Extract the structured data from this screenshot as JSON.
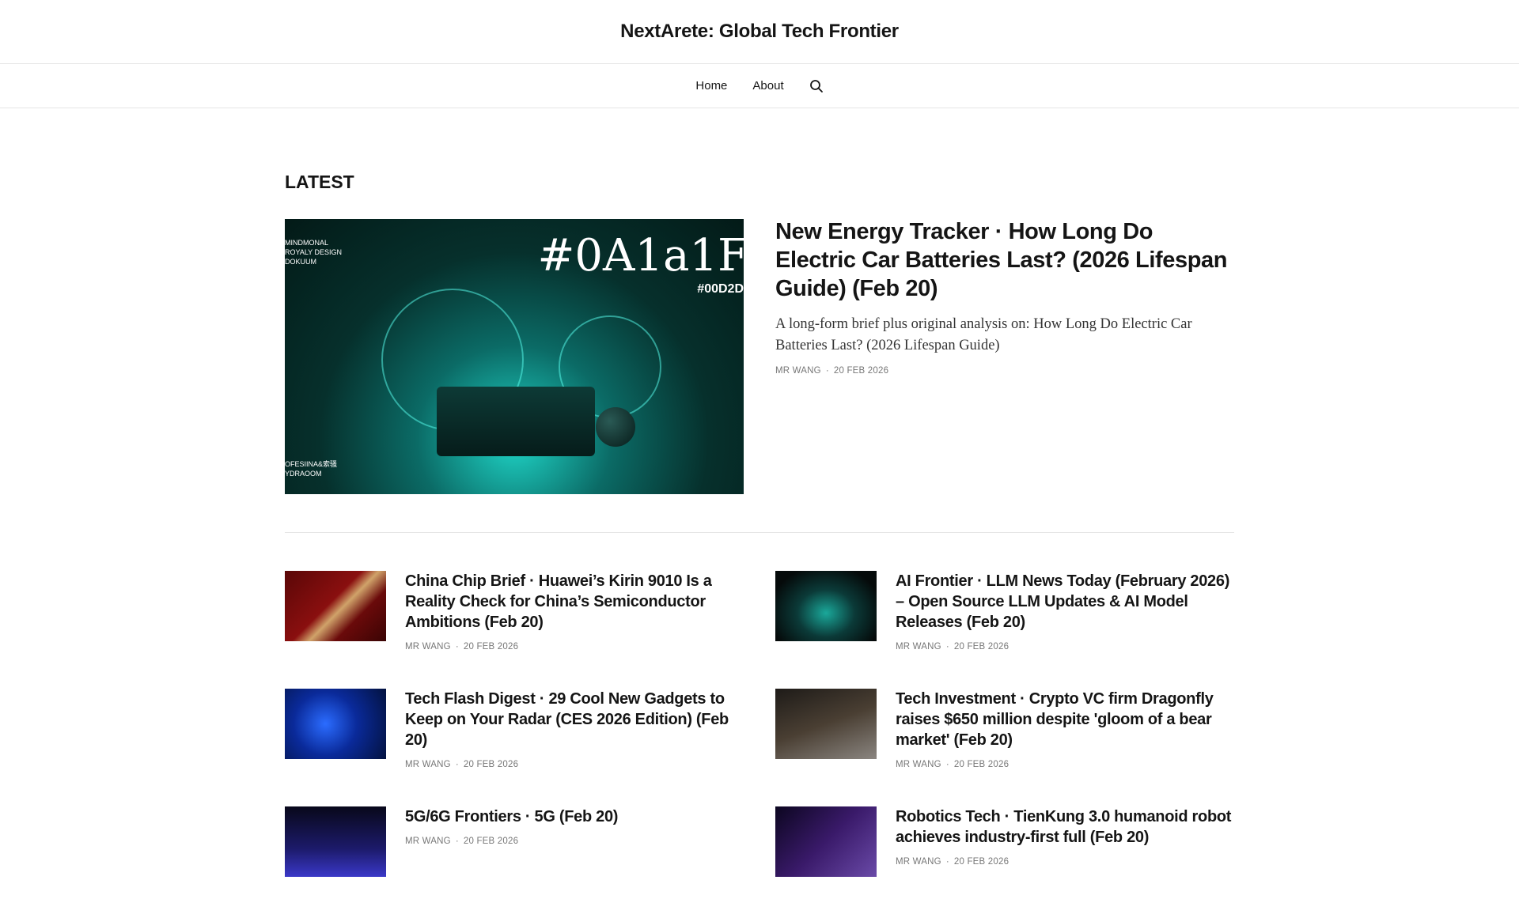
{
  "site": {
    "title": "NextArete: Global Tech Frontier"
  },
  "nav": {
    "items": [
      {
        "label": "Home"
      },
      {
        "label": "About"
      }
    ],
    "search_icon": "search-icon"
  },
  "section": {
    "title": "LATEST"
  },
  "featured": {
    "title": "New Energy Tracker · How Long Do Electric Car Batteries Last? (2026 Lifespan Guide) (Feb 20)",
    "excerpt": "A long-form brief plus original analysis on: How Long Do Electric Car Batteries Last? (2026 Lifespan Guide)",
    "author": "MR WANG",
    "date": "20 FEB 2026",
    "image_text": {
      "big": "#0A1a1F",
      "small": "#00D2D",
      "top": "MINDMONAL\nROYALY DESIGN\nDOKUUM",
      "bottom": "OFESIINA&索骚\nYDRAOOM"
    }
  },
  "posts": [
    {
      "title": "China Chip Brief · Huawei’s Kirin 9010 Is a Reality Check for China’s Semiconductor Ambitions (Feb 20)",
      "author": "MR WANG",
      "date": "20 FEB 2026",
      "thumb": "linear-gradient(135deg,#5a0707 0%,#8a0f0f 45%,#d0a36a 55%,#6a0a0a 70%,#3a0404 100%)"
    },
    {
      "title": "AI Frontier · LLM News Today (February 2026) – Open Source LLM Updates & AI Model Releases (Feb 20)",
      "author": "MR WANG",
      "date": "20 FEB 2026",
      "thumb": "radial-gradient(ellipse at 50% 60%,#1aa89a 0%,#0b3a38 40%,#050a0a 80%)"
    },
    {
      "title": "Tech Flash Digest · 29 Cool New Gadgets to Keep on Your Radar (CES 2026 Edition) (Feb 20)",
      "author": "MR WANG",
      "date": "20 FEB 2026",
      "thumb": "radial-gradient(circle at 40% 50%,#2b6cff 0%,#0a2a9a 45%,#03123f 100%)"
    },
    {
      "title": "Tech Investment · Crypto VC firm Dragonfly raises $650 million despite 'gloom of a bear market' (Feb 20)",
      "author": "MR WANG",
      "date": "20 FEB 2026",
      "thumb": "linear-gradient(160deg,#1e1b18 0%,#4a3f33 50%,#8a8580 100%)"
    },
    {
      "title": "5G/6G Frontiers · 5G (Feb 20)",
      "author": "MR WANG",
      "date": "20 FEB 2026",
      "thumb": "linear-gradient(180deg,#08081a 0%,#1c1a6a 60%,#3a38c8 100%)"
    },
    {
      "title": "Robotics Tech · TienKung 3.0 humanoid robot achieves industry-first full (Feb 20)",
      "author": "MR WANG",
      "date": "20 FEB 2026",
      "thumb": "linear-gradient(135deg,#0c0620 0%,#3a1a6a 50%,#6a4aa8 100%)"
    }
  ]
}
